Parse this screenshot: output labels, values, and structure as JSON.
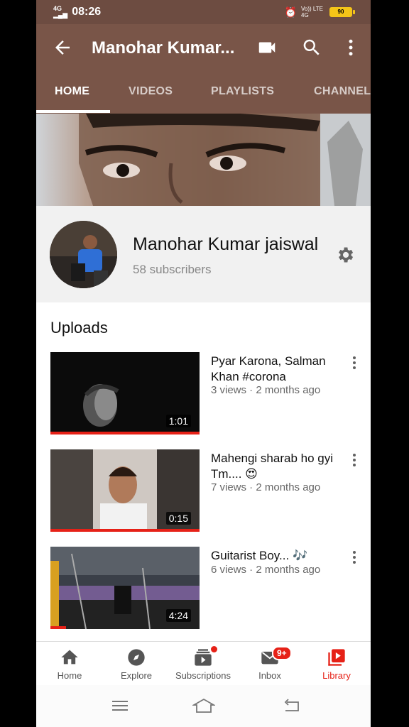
{
  "status_bar": {
    "network": "4G",
    "time": "08:26",
    "carrier": "Vo)) LTE 4G",
    "battery": "90"
  },
  "app_bar": {
    "title": "Manohar Kumar..."
  },
  "tabs": [
    {
      "label": "HOME",
      "active": true
    },
    {
      "label": "VIDEOS",
      "active": false
    },
    {
      "label": "PLAYLISTS",
      "active": false
    },
    {
      "label": "CHANNELS",
      "active": false
    }
  ],
  "channel": {
    "name": "Manohar Kumar jaiswal",
    "subscribers": "58 subscribers"
  },
  "uploads": {
    "title": "Uploads",
    "videos": [
      {
        "title": "Pyar Karona, Salman Khan #corona",
        "meta": "3 views · 2 months ago",
        "duration": "1:01"
      },
      {
        "title": "Mahengi sharab ho gyi Tm.... 😍",
        "meta": "7 views · 2 months ago",
        "duration": "0:15"
      },
      {
        "title": "Guitarist Boy... 🎶",
        "meta": "6 views · 2 months ago",
        "duration": "4:24"
      }
    ]
  },
  "bottom_nav": [
    {
      "label": "Home",
      "icon": "home-icon"
    },
    {
      "label": "Explore",
      "icon": "explore-icon"
    },
    {
      "label": "Subscriptions",
      "icon": "subscriptions-icon"
    },
    {
      "label": "Inbox",
      "icon": "inbox-icon",
      "badge": "9+"
    },
    {
      "label": "Library",
      "icon": "library-icon",
      "active": true
    }
  ],
  "colors": {
    "brand": "#795548",
    "status_bar": "#6d4c41",
    "accent": "#e62117"
  }
}
